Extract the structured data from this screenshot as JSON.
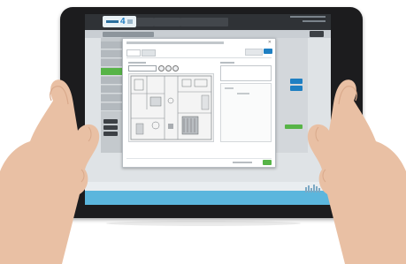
{
  "app": {
    "logo_number": "4"
  },
  "icons": [
    "camera-icon",
    "floor-plan-icon",
    "hand-left",
    "hand-right"
  ],
  "colors": {
    "tablet": "#1c1c1e",
    "accent_green": "#57b447",
    "accent_blue": "#1e7fc2",
    "skin": "#e9c0a4"
  }
}
